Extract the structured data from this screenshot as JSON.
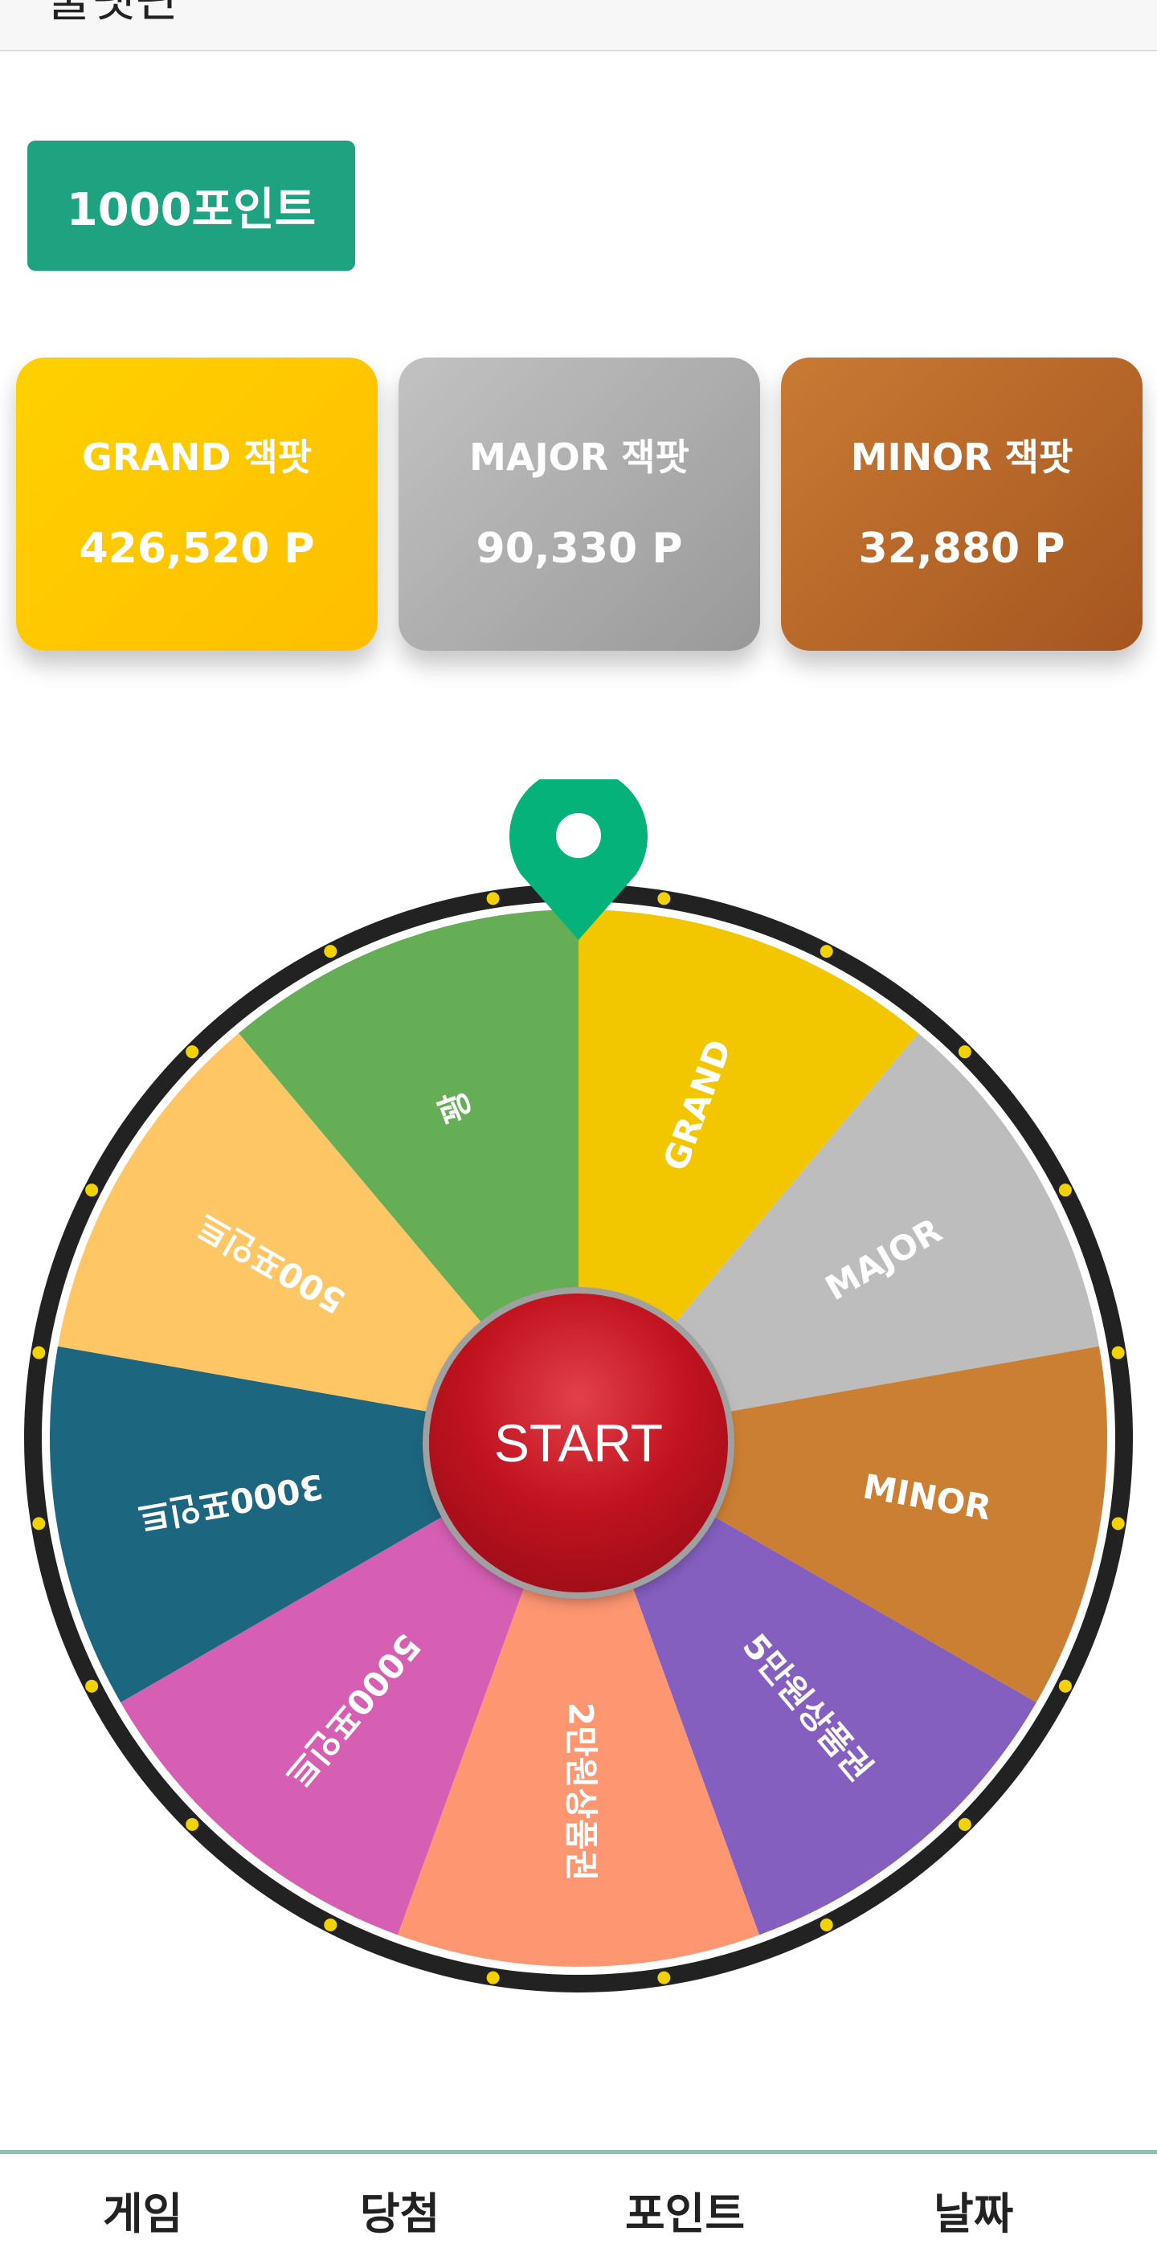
{
  "header": {
    "title": "룰렛판"
  },
  "points_button": {
    "label": "1000포인트"
  },
  "jackpots": [
    {
      "title": "GRAND 잭팟",
      "value": "426,520 P",
      "color": "#ffc800"
    },
    {
      "title": "MAJOR 잭팟",
      "value": "90,330 P",
      "color": "#b0b0b0"
    },
    {
      "title": "MINOR 잭팟",
      "value": "32,880 P",
      "color": "#b86828"
    }
  ],
  "wheel": {
    "start_label": "START",
    "pointer_color": "#05b37a",
    "segments": [
      {
        "label": "GRAND",
        "color": "#f2c700"
      },
      {
        "label": "MAJOR",
        "color": "#bdbdbd"
      },
      {
        "label": "MINOR",
        "color": "#cb7f33"
      },
      {
        "label": "5만원상품권",
        "color": "#845fc0"
      },
      {
        "label": "2만원상품권",
        "color": "#fd9671"
      },
      {
        "label": "5000포인트",
        "color": "#d65fb3"
      },
      {
        "label": "3000포인트",
        "color": "#1d6680"
      },
      {
        "label": "500포인트",
        "color": "#fec664"
      },
      {
        "label": "꽝",
        "color": "#65ae56"
      }
    ]
  },
  "bottom_nav": {
    "items": [
      {
        "label": "게임"
      },
      {
        "label": "당첨"
      },
      {
        "label": "포인트"
      },
      {
        "label": "날짜"
      }
    ]
  }
}
